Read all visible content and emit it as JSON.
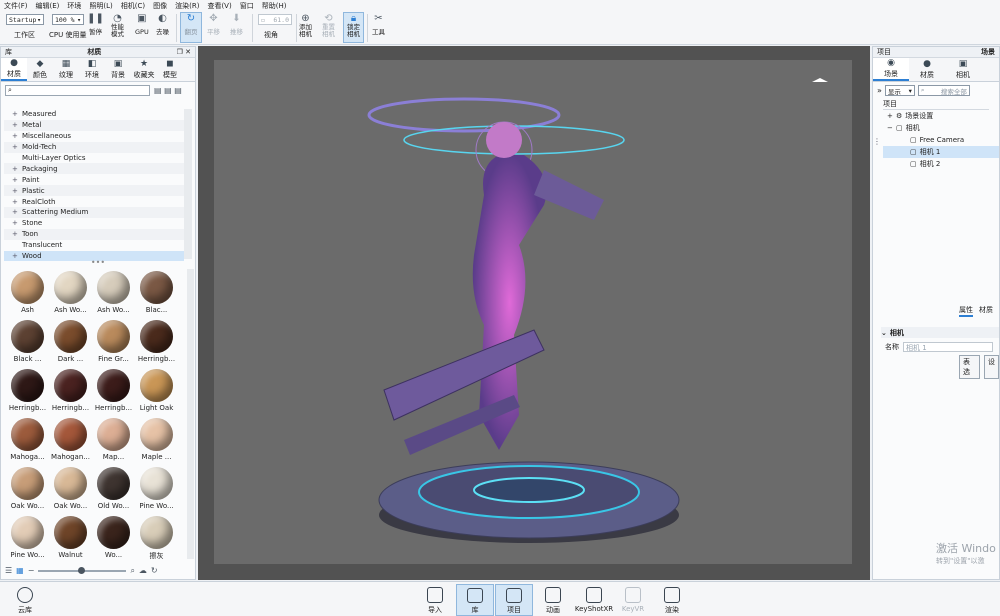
{
  "menu": [
    "文件(F)",
    "编辑(E)",
    "环境",
    "照明(L)",
    "相机(C)",
    "图像",
    "渲染(R)",
    "查看(V)",
    "窗口",
    "帮助(H)"
  ],
  "toolbar": {
    "startup_value": "Startup",
    "zoom_value": "100 %",
    "workspace_label": "工作区",
    "cpu_usage_label": "CPU 使用量",
    "pause_label": "暂停",
    "perf_label": "性能\n模式",
    "gpu_label": "GPU",
    "denoise_label": "去噪",
    "refresh_label": "翻页",
    "pan_label": "平移",
    "push_label": "推移",
    "fov_value": "61.0",
    "view_label": "视角",
    "add_camera_label": "添加\n相机",
    "reset_camera_label": "重置\n相机",
    "lock_camera_label": "锁定\n相机",
    "tools_label": "工具"
  },
  "library": {
    "panel_title": "库",
    "section_title": "材质",
    "tabs": [
      "材质",
      "颜色",
      "纹理",
      "环境",
      "背景",
      "收藏夹",
      "模型"
    ],
    "tree_items": [
      "Measured",
      "Metal",
      "Miscellaneous",
      "Mold-Tech",
      "Multi-Layer Optics",
      "Packaging",
      "Paint",
      "Plastic",
      "RealCloth",
      "Scattering Medium",
      "Stone",
      "Toon",
      "Translucent",
      "Wood"
    ],
    "tree_expand": [
      true,
      true,
      true,
      true,
      false,
      true,
      true,
      true,
      true,
      true,
      true,
      true,
      false,
      true
    ],
    "selected_item": "Wood",
    "swatches": [
      {
        "name": "Ash",
        "color": "#c79a6f"
      },
      {
        "name": "Ash Wo...",
        "color": "#e2d6c2"
      },
      {
        "name": "Ash Wo...",
        "color": "#d6ccbb"
      },
      {
        "name": "Blac...",
        "color": "#7a5844"
      },
      {
        "name": "Black ...",
        "color": "#5c4132"
      },
      {
        "name": "Dark ...",
        "color": "#7a4c2c"
      },
      {
        "name": "Fine Gr...",
        "color": "#b98a5c"
      },
      {
        "name": "Herringb...",
        "color": "#4a2a1c"
      },
      {
        "name": "Herringb...",
        "color": "#2e1816"
      },
      {
        "name": "Herringb...",
        "color": "#4a2220"
      },
      {
        "name": "Herringb...",
        "color": "#3c1c1a"
      },
      {
        "name": "Light Oak",
        "color": "#c99656"
      },
      {
        "name": "Mahoga...",
        "color": "#9c5b3c"
      },
      {
        "name": "Mahogan...",
        "color": "#a4573a"
      },
      {
        "name": "Map...",
        "color": "#dcae94"
      },
      {
        "name": "Maple ...",
        "color": "#e6c2a6"
      },
      {
        "name": "Oak Wo...",
        "color": "#c79d78"
      },
      {
        "name": "Oak Wo...",
        "color": "#d8b896"
      },
      {
        "name": "Old Wo...",
        "color": "#3e3430"
      },
      {
        "name": "Pine Wo...",
        "color": "#e8e2d6"
      },
      {
        "name": "Pine Wo...",
        "color": "#e2ccb6"
      },
      {
        "name": "Walnut",
        "color": "#6e4428"
      },
      {
        "name": "Wo...",
        "color": "#3a241c"
      },
      {
        "name": "擦灰",
        "color": "#d8cdb8"
      }
    ],
    "cloud_label": "云库"
  },
  "project": {
    "panel_title": "项目",
    "section_title": "场景",
    "tabs": [
      "场景",
      "材质",
      "相机"
    ],
    "display_label": "显示",
    "search_placeholder": "搜索全部",
    "tree_header": "项目",
    "tree_items": [
      "场景设置",
      "相机",
      "Free Camera",
      "相机 1",
      "相机 2"
    ],
    "selected_item": "相机 1",
    "props_tabs": [
      "属性",
      "材质"
    ],
    "section_camera": "相机",
    "name_label": "名称",
    "name_value": "相机 1",
    "btn_table": "表选",
    "btn_settings": "设"
  },
  "bottom": {
    "buttons": [
      "导入",
      "库",
      "项目",
      "动画",
      "KeyShotXR",
      "KeyVR",
      "渲染"
    ],
    "active": [
      "库",
      "项目"
    ],
    "disabled": [
      "KeyVR"
    ]
  },
  "watermark": {
    "line1": "激活 Windo",
    "line2": "转到\"设置\"以激"
  }
}
